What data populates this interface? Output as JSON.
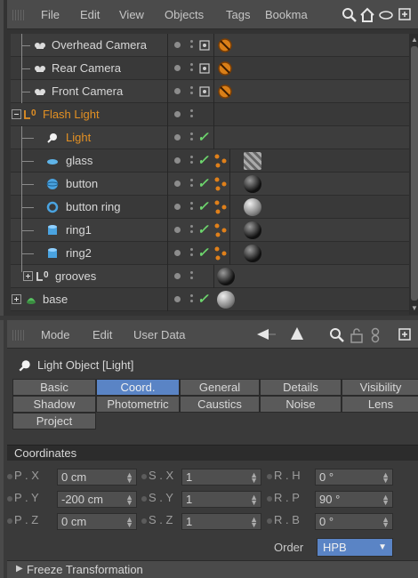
{
  "object_manager": {
    "menu": [
      "File",
      "Edit",
      "View",
      "Objects",
      "Tags",
      "Bookma"
    ],
    "toolbar_icons": [
      "search-icon",
      "home-icon",
      "layer-icon",
      "expand-icon"
    ],
    "objects": [
      {
        "name": "Overhead Camera",
        "type": "camera",
        "level": 1
      },
      {
        "name": "Rear Camera",
        "type": "camera",
        "level": 1
      },
      {
        "name": "Front Camera",
        "type": "camera",
        "level": 1
      },
      {
        "name": "Flash Light",
        "type": "null",
        "level": 0,
        "highlight": true
      },
      {
        "name": "Light",
        "type": "light",
        "level": 1,
        "selected": true
      },
      {
        "name": "glass",
        "type": "disc",
        "level": 1
      },
      {
        "name": "button",
        "type": "sphere",
        "level": 1
      },
      {
        "name": "button ring",
        "type": "torus",
        "level": 1
      },
      {
        "name": "ring1",
        "type": "cylinder",
        "level": 1
      },
      {
        "name": "ring2",
        "type": "cylinder",
        "level": 1
      },
      {
        "name": "grooves",
        "type": "null",
        "level": 1
      },
      {
        "name": "base",
        "type": "lathe",
        "level": 0
      }
    ]
  },
  "attribute_manager": {
    "menu": [
      "Mode",
      "Edit",
      "User Data"
    ],
    "title": "Light Object [Light]",
    "tabs_row1": [
      "Basic",
      "Coord.",
      "General",
      "Details",
      "Visibility"
    ],
    "tabs_row2": [
      "Shadow",
      "Photometric",
      "Caustics",
      "Noise",
      "Lens"
    ],
    "tabs_row3": [
      "Project"
    ],
    "active_tab": "Coord.",
    "section": "Coordinates",
    "fields": {
      "px_label": "P . X",
      "px": "0 cm",
      "py_label": "P . Y",
      "py": "-200 cm",
      "pz_label": "P . Z",
      "pz": "0 cm",
      "sx_label": "S . X",
      "sx": "1",
      "sy_label": "S . Y",
      "sy": "1",
      "sz_label": "S . Z",
      "sz": "1",
      "rh_label": "R . H",
      "rh": "0 °",
      "rp_label": "R . P",
      "rp": "90 °",
      "rb_label": "R . B",
      "rb": "0 °"
    },
    "order_label": "Order",
    "order_value": "HPB",
    "freeze_label": "Freeze Transformation"
  },
  "colors": {
    "accent": "#5a84c5",
    "highlight": "#e39023",
    "check": "#6cd36c"
  }
}
